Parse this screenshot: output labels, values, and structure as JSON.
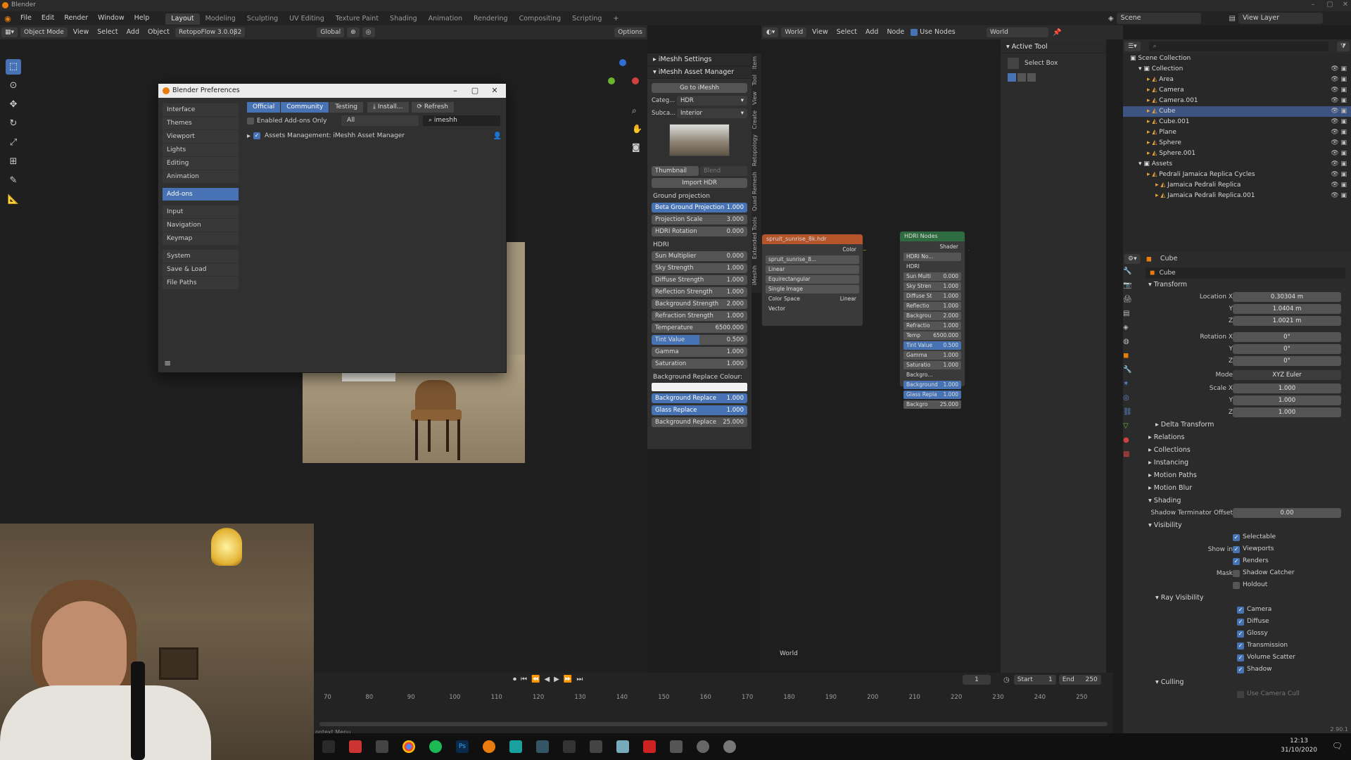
{
  "window": {
    "title": "Blender"
  },
  "menubar": {
    "menus": [
      "File",
      "Edit",
      "Render",
      "Window",
      "Help"
    ],
    "workspaces": [
      "Layout",
      "Modeling",
      "Sculpting",
      "UV Editing",
      "Texture Paint",
      "Shading",
      "Animation",
      "Rendering",
      "Compositing",
      "Scripting"
    ],
    "active_workspace": "Layout",
    "scene": "Scene",
    "view_layer": "View Layer"
  },
  "viewport_header": {
    "mode": "Object Mode",
    "menus": [
      "View",
      "Select",
      "Add",
      "Object"
    ],
    "addon": "RetopoFlow 3.0.0β2",
    "transform": "Global",
    "options": "Options"
  },
  "preferences": {
    "title": "Blender Preferences",
    "nav_groups": [
      [
        "Interface",
        "Themes",
        "Viewport",
        "Lights",
        "Editing",
        "Animation"
      ],
      [
        "Add-ons"
      ],
      [
        "Input",
        "Navigation",
        "Keymap"
      ],
      [
        "System",
        "Save & Load",
        "File Paths"
      ]
    ],
    "active_nav": "Add-ons",
    "filter_tabs": [
      "Official",
      "Community",
      "Testing"
    ],
    "install_label": "Install...",
    "refresh_label": "Refresh",
    "enabled_only_label": "Enabled Add-ons Only",
    "category": "All",
    "search_value": "imeshh",
    "addon_entry": "Assets Management: iMeshh Asset Manager"
  },
  "imeshh_panel": {
    "settings_header": "iMeshh Settings",
    "manager_header": "iMeshh Asset Manager",
    "go_button": "Go to iMeshh",
    "category_label": "Categ...",
    "category_value": "HDR",
    "subcategory_label": "Subca...",
    "subcategory_value": "Interior",
    "thumbnail_label": "Thumbnail",
    "blend_label": "Blend",
    "import_button": "Import HDR",
    "ground_header": "Ground projection",
    "ground_sliders": [
      {
        "label": "Beta Ground Projection",
        "value": "1.000",
        "style": "blue"
      },
      {
        "label": "Projection Scale",
        "value": "3.000",
        "style": "gray"
      },
      {
        "label": "HDRI Rotation",
        "value": "0.000",
        "style": "gray"
      }
    ],
    "hdri_header": "HDRI",
    "hdri_sliders": [
      {
        "label": "Sun Multiplier",
        "value": "0.000",
        "style": "gray"
      },
      {
        "label": "Sky Strength",
        "value": "1.000",
        "style": "gray"
      },
      {
        "label": "Diffuse Strength",
        "value": "1.000",
        "style": "gray"
      },
      {
        "label": "Reflection Strength",
        "value": "1.000",
        "style": "gray"
      },
      {
        "label": "Background Strength",
        "value": "2.000",
        "style": "gray"
      },
      {
        "label": "Refraction Strength",
        "value": "1.000",
        "style": "gray"
      },
      {
        "label": "Temperature",
        "value": "6500.000",
        "style": "gray"
      },
      {
        "label": "Tint Value",
        "value": "0.500",
        "style": "half"
      },
      {
        "label": "Gamma",
        "value": "1.000",
        "style": "gray"
      },
      {
        "label": "Saturation",
        "value": "1.000",
        "style": "gray"
      }
    ],
    "bg_colour_label": "Background Replace Colour:",
    "replace_sliders": [
      {
        "label": "Background Replace",
        "value": "1.000",
        "style": "blue"
      },
      {
        "label": "Glass Replace",
        "value": "1.000",
        "style": "blue"
      },
      {
        "label": "Background Replace",
        "value": "25.000",
        "style": "gray"
      }
    ],
    "vertical_tabs": [
      "Item",
      "Tool",
      "View",
      "Create",
      "Retopology",
      "Quad Remesh",
      "Extended Tools",
      "iMeshh"
    ]
  },
  "node_editor": {
    "header_menus": [
      "View",
      "Select",
      "Add",
      "Node"
    ],
    "world_selector": "World",
    "use_nodes": "Use Nodes",
    "world_name": "World",
    "image_node": {
      "title": "spruit_sunrise_8k.hdr",
      "output": "Color",
      "file": "spruit_sunrise_8...",
      "rows": [
        "Linear",
        "Equirectangular",
        "Single Image"
      ],
      "color_space_label": "Color Space",
      "color_space": "Linear",
      "vector": "Vector"
    },
    "hdri_node": {
      "title": "HDRI Nodes",
      "output": "Shader",
      "group": "HDRI No...",
      "section": "HDRI",
      "rows": [
        {
          "label": "Sun Multi",
          "value": "0.000",
          "style": "gray"
        },
        {
          "label": "Sky Stren",
          "value": "1.000",
          "style": "gray"
        },
        {
          "label": "Diffuse St",
          "value": "1.000",
          "style": "gray"
        },
        {
          "label": "Reflectio",
          "value": "1.000",
          "style": "gray"
        },
        {
          "label": "Backgrou",
          "value": "2.000",
          "style": "gray"
        },
        {
          "label": "Refractio",
          "value": "1.000",
          "style": "gray"
        },
        {
          "label": "Temp",
          "value": "6500.000",
          "style": "gray"
        },
        {
          "label": "Tint Value",
          "value": "0.500",
          "style": "blue"
        },
        {
          "label": "Gamma",
          "value": "1.000",
          "style": "gray"
        },
        {
          "label": "Saturatio",
          "value": "1.000",
          "style": "gray"
        },
        {
          "label": "Backgro...",
          "value": "",
          "style": "plain"
        },
        {
          "label": "Background",
          "value": "1.000",
          "style": "blue"
        },
        {
          "label": "Glass Repla",
          "value": "1.000",
          "style": "blue"
        },
        {
          "label": "Backgro",
          "value": "25.000",
          "style": "gray"
        }
      ]
    }
  },
  "active_tool": {
    "header": "Active Tool",
    "tool": "Select Box"
  },
  "outliner": {
    "root": "Scene Collection",
    "items": [
      {
        "name": "Collection",
        "depth": 1,
        "selected": false
      },
      {
        "name": "Area",
        "depth": 2,
        "selected": false
      },
      {
        "name": "Camera",
        "depth": 2,
        "selected": false
      },
      {
        "name": "Camera.001",
        "depth": 2,
        "selected": false
      },
      {
        "name": "Cube",
        "depth": 2,
        "selected": true
      },
      {
        "name": "Cube.001",
        "depth": 2,
        "selected": false
      },
      {
        "name": "Plane",
        "depth": 2,
        "selected": false
      },
      {
        "name": "Sphere",
        "depth": 2,
        "selected": false
      },
      {
        "name": "Sphere.001",
        "depth": 2,
        "selected": false
      },
      {
        "name": "Assets",
        "depth": 1,
        "selected": false
      },
      {
        "name": "Pedrali Jamaica Replica Cycles",
        "depth": 2,
        "selected": false
      },
      {
        "name": "Jamaica Pedrali Replica",
        "depth": 3,
        "selected": false
      },
      {
        "name": "Jamaica Pedrali Replica.001",
        "depth": 3,
        "selected": false
      }
    ]
  },
  "properties": {
    "object_name": "Cube",
    "data_name": "Cube",
    "transform_header": "Transform",
    "location": {
      "label": "Location X",
      "x": "0.30304 m",
      "y": "1.0404 m",
      "z": "1.0021 m"
    },
    "rotation": {
      "label": "Rotation X",
      "x": "0°",
      "y": "0°",
      "z": "0°"
    },
    "mode_label": "Mode",
    "mode_value": "XYZ Euler",
    "scale": {
      "label": "Scale X",
      "x": "1.000",
      "y": "1.000",
      "z": "1.000"
    },
    "axis_y": "Y",
    "axis_z": "Z",
    "collapsed_sections": [
      "Delta Transform",
      "Relations",
      "Collections",
      "Instancing",
      "Motion Paths",
      "Motion Blur"
    ],
    "shading_header": "Shading",
    "shadow_offset_label": "Shadow Terminator Offset",
    "shadow_offset_value": "0.00",
    "visibility_header": "Visibility",
    "selectable": "Selectable",
    "show_in_label": "Show in",
    "viewports": "Viewports",
    "renders": "Renders",
    "mask_label": "Mask",
    "shadow_catcher": "Shadow Catcher",
    "holdout": "Holdout",
    "ray_visibility_header": "Ray Visibility",
    "ray_items": [
      "Camera",
      "Diffuse",
      "Glossy",
      "Transmission",
      "Volume Scatter",
      "Shadow"
    ],
    "culling_header": "Culling",
    "use_camera_cull": "Use Camera Cull",
    "version": "2.90.1"
  },
  "timeline": {
    "current_frame": "1",
    "start_label": "Start",
    "start_value": "1",
    "end_label": "End",
    "end_value": "250",
    "ticks": [
      "70",
      "80",
      "90",
      "100",
      "110",
      "120",
      "130",
      "140",
      "150",
      "160",
      "170",
      "180",
      "190",
      "200",
      "210",
      "220",
      "230",
      "240",
      "250"
    ]
  },
  "status_bar": {
    "text": "ontext Menu"
  },
  "taskbar": {
    "time": "12:13",
    "date": "31/10/2020"
  },
  "colors": {
    "accent": "#4772b3",
    "orange": "#e87d0d",
    "node_image_header": "#b5532a",
    "node_group_header": "#2e6b3f"
  }
}
